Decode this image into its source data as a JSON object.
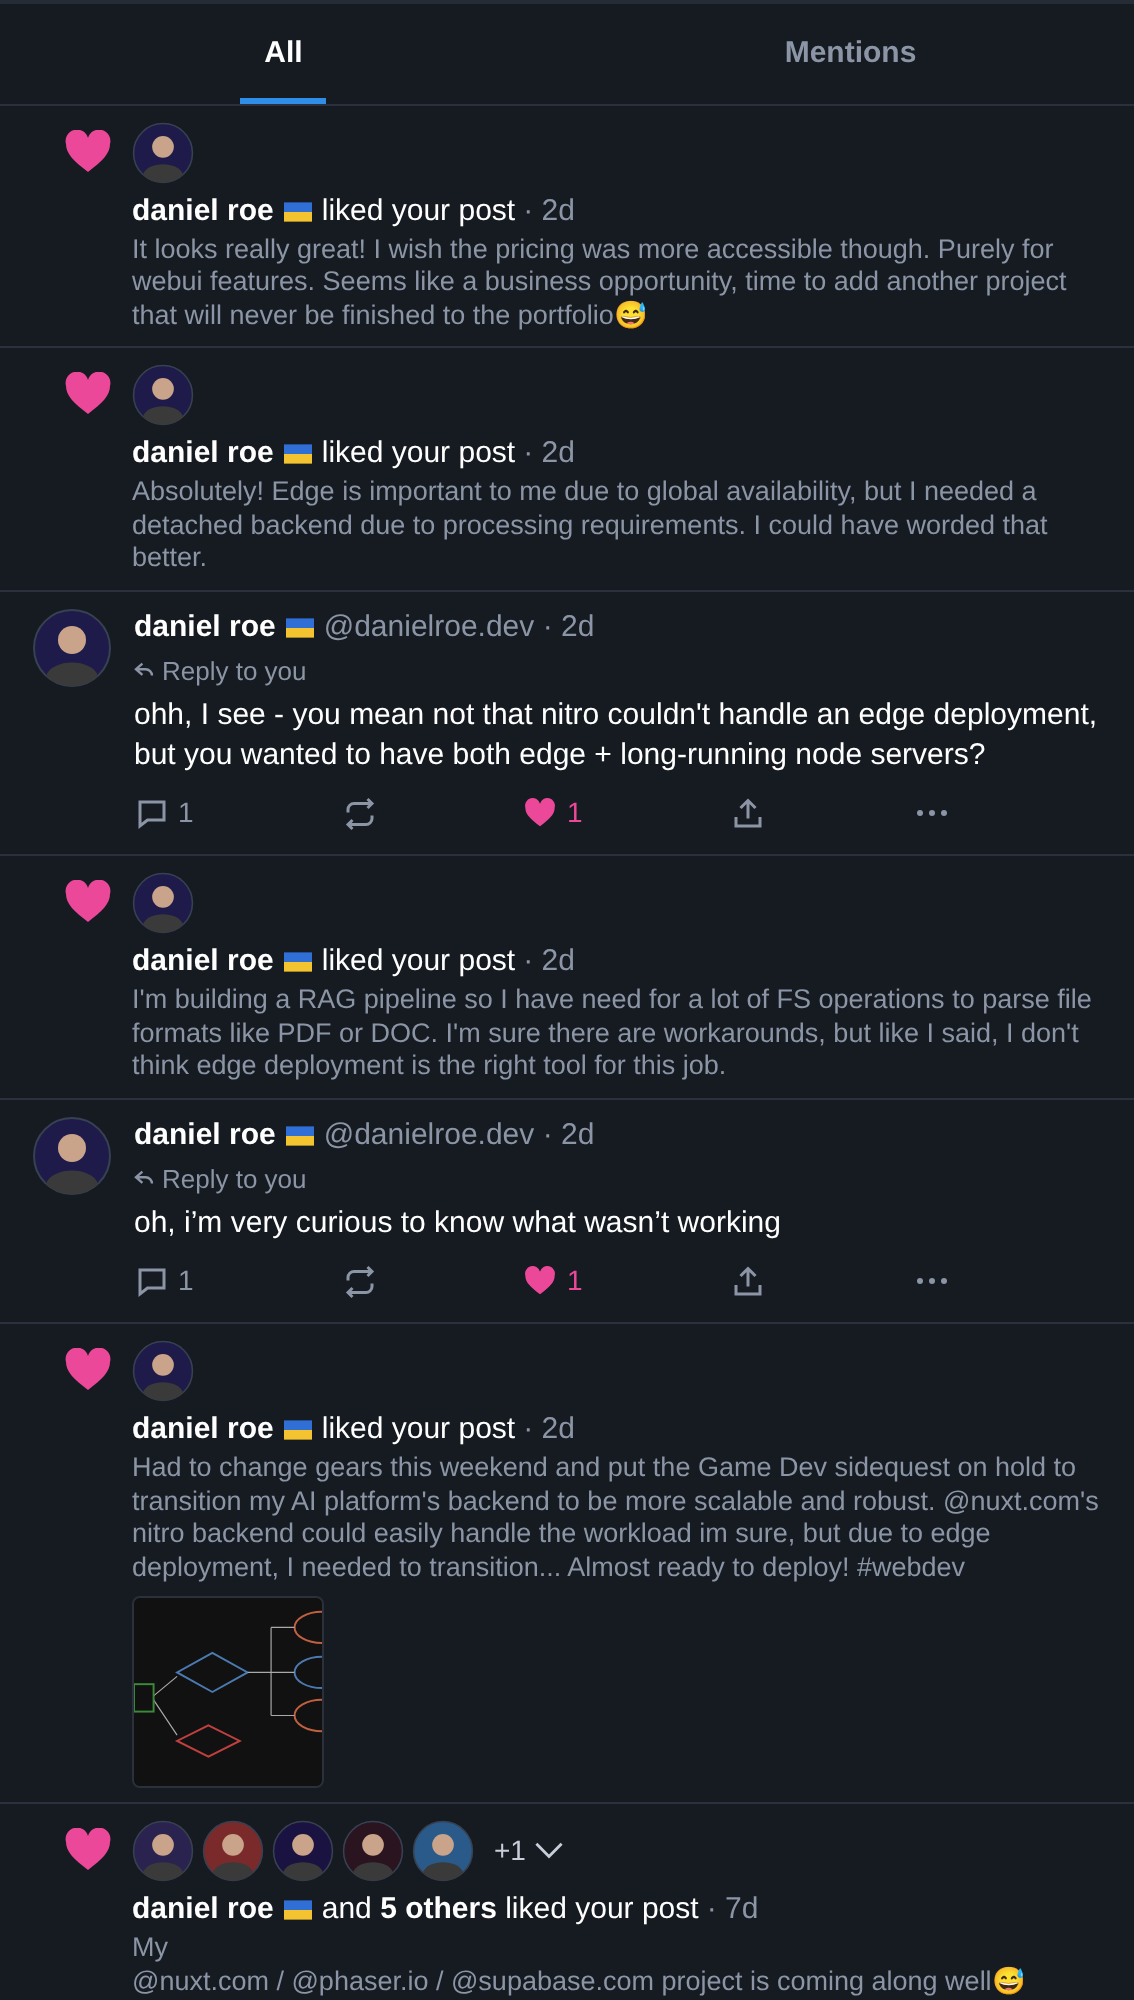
{
  "tabs": [
    {
      "label": "All",
      "selected": true
    },
    {
      "label": "Mentions",
      "selected": false
    }
  ],
  "items": [
    {
      "kind": "like",
      "name": "daniel roe",
      "action": "liked your post",
      "time": "· 2d",
      "text": "It looks really great! I wish the pricing was more accessible though. Purely for webui features. Seems like a business opportunity, time to add another project that will never be finished to the portfolio😅"
    },
    {
      "kind": "like",
      "name": "daniel roe",
      "action": "liked your post",
      "time": "· 2d",
      "text": "Absolutely! Edge is important to me due to global availability, but I needed a detached backend due to processing requirements. I could have worded that better."
    },
    {
      "kind": "reply",
      "name": "daniel roe",
      "handle": "@danielroe.dev · 2d",
      "reply_to": "Reply to you",
      "text": "ohh, I see - you mean not that nitro couldn't handle an edge deployment, but you wanted to have both edge + long-running node servers?",
      "comments": "1",
      "likes": "1",
      "liked": true
    },
    {
      "kind": "like",
      "name": "daniel roe",
      "action": "liked your post",
      "time": "· 2d",
      "text": "I'm building a RAG pipeline so I have need for a lot of FS operations to parse file formats like PDF or DOC. I'm sure there are workarounds, but like I said, I don't think edge deployment is the right tool for this job."
    },
    {
      "kind": "reply",
      "name": "daniel roe",
      "handle": "@danielroe.dev · 2d",
      "reply_to": "Reply to you",
      "text": "oh, i’m very curious to know what wasn’t working",
      "comments": "1",
      "likes": "1",
      "liked": true
    },
    {
      "kind": "like",
      "name": "daniel roe",
      "action": "liked your post",
      "time": "· 2d",
      "text": "Had to change gears this weekend and put the Game Dev sidequest on hold to transition my AI platform's backend to be more scalable and robust. @nuxt.com's nitro backend could easily handle the workload im sure, but due to edge deployment, I needed to transition... Almost ready to deploy! #webdev"
    },
    {
      "kind": "group_like",
      "name": "daniel roe",
      "others": "and **5 others** liked your post",
      "time": "· 7d",
      "avatars": [
        {
          "color": "#2a2350"
        },
        {
          "color": "#7a2a2a"
        },
        {
          "color": "#1a1240"
        },
        {
          "color": "#2a1420"
        },
        {
          "color": "#2a5a8a"
        }
      ],
      "more": "+1",
      "text": "My\n@nuxt.com / @phaser.io / @supabase.com project is coming along well😅"
    }
  ]
}
